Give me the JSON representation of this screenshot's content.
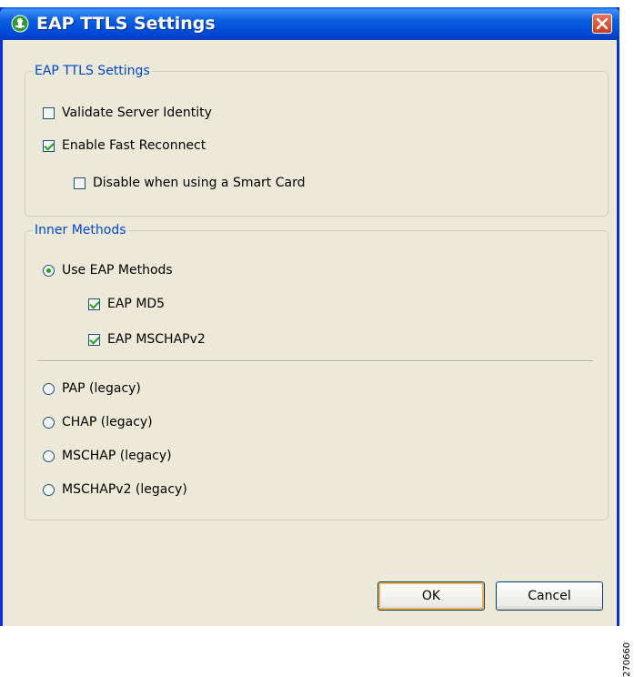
{
  "window": {
    "title": "EAP TTLS Settings",
    "icon": "green-shield-icon",
    "close_icon": "close-icon"
  },
  "eap_ttls_group": {
    "legend": "EAP TTLS Settings",
    "validate_server_identity": {
      "label": "Validate Server Identity",
      "checked": false
    },
    "enable_fast_reconnect": {
      "label": "Enable Fast Reconnect",
      "checked": true
    },
    "disable_smart_card": {
      "label": "Disable when using a Smart Card",
      "checked": false
    }
  },
  "inner_methods_group": {
    "legend": "Inner Methods",
    "use_eap_methods": {
      "label": "Use EAP Methods",
      "selected": true
    },
    "eap_md5": {
      "label": "EAP MD5",
      "checked": true
    },
    "eap_mschapv2": {
      "label": "EAP MSCHAPv2",
      "checked": true
    },
    "pap": {
      "label": "PAP (legacy)",
      "selected": false
    },
    "chap": {
      "label": "CHAP (legacy)",
      "selected": false
    },
    "mschap": {
      "label": "MSCHAP (legacy)",
      "selected": false
    },
    "mschapv2": {
      "label": "MSCHAPv2 (legacy)",
      "selected": false
    }
  },
  "buttons": {
    "ok": "OK",
    "cancel": "Cancel"
  },
  "watermark": "270660",
  "colors": {
    "titlebar": "#0a5fde",
    "client_bg": "#ece9d8",
    "legend_text": "#0046d5",
    "check": "#21a121"
  }
}
